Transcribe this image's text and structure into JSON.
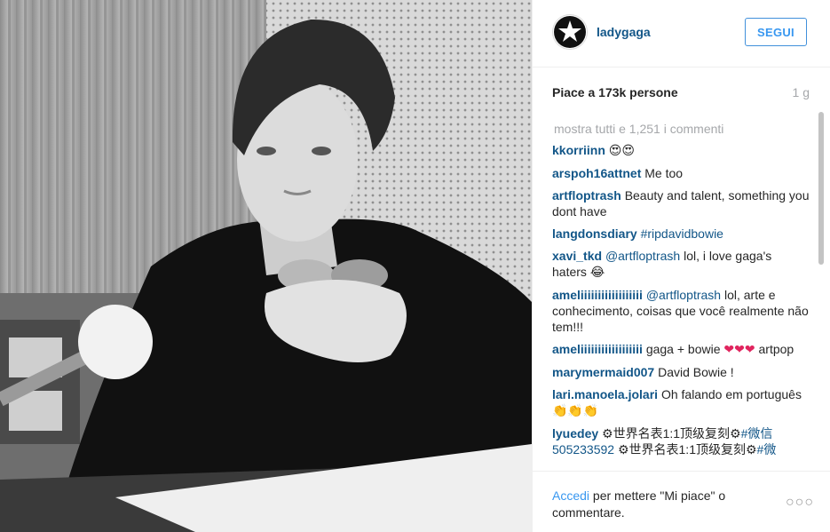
{
  "post": {
    "username": "ladygaga",
    "follow_label": "SEGUI",
    "likes": "Piace a 173k persone",
    "time": "1 g"
  },
  "comments_section": {
    "show_all": "mostra tutti e 1,251 i commenti",
    "comments": [
      {
        "user": "kkorriinn",
        "text": "",
        "emoji": "😍😍"
      },
      {
        "user": "arspoh16attnet",
        "text": "Me too"
      },
      {
        "user": "artfloptrash",
        "text": "Beauty and talent, something you dont have"
      },
      {
        "user": "langdonsdiary",
        "text": "",
        "tag": "#ripdavidbowie"
      },
      {
        "user": "xavi_tkd",
        "mention": "@artfloptrash",
        "text": " lol, i love gaga's haters ",
        "emoji": "😂"
      },
      {
        "user": "ameliiiiiiiiiiiiiiiiii",
        "mention": "@artfloptrash",
        "text": " lol, arte e conhecimento, coisas que você realmente não tem!!!"
      },
      {
        "user": "ameliiiiiiiiiiiiiiiiii",
        "text": "gaga + bowie ",
        "emoji": "❤❤❤",
        "text2": " artpop"
      },
      {
        "user": "marymermaid007",
        "text": "David Bowie !"
      },
      {
        "user": "lari.manoela.jolari",
        "text": "Oh falando em português ",
        "emoji": "👏👏👏"
      },
      {
        "user": "lyuedey",
        "text": "⚙世界名表1:1顶级复刻⚙",
        "tag": "#微信",
        "text2": "505233592",
        "text3": " ⚙世界名表1:1顶级复刻⚙",
        "tag2": "#微"
      }
    ]
  },
  "footer": {
    "login_link": "Accedi",
    "login_text": " per mettere \"Mi piace\" o commentare.",
    "more_icon": "ellipsis-icon"
  },
  "colors": {
    "username_blue": "#125688",
    "accent_blue": "#3897f0",
    "muted_gray": "#a5a7aa"
  }
}
